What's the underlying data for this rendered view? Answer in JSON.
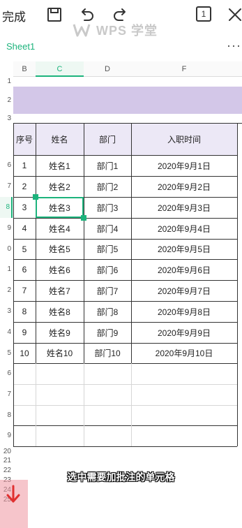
{
  "topbar": {
    "done_label": "完成",
    "page_count": "1",
    "icons": [
      "save-icon",
      "undo-icon",
      "redo-icon",
      "close-icon"
    ]
  },
  "watermark": {
    "text": "WPS 学堂"
  },
  "tabs": {
    "sheet_label": "Sheet1",
    "more_label": "···"
  },
  "columns": [
    "B",
    "C",
    "D",
    "F"
  ],
  "rows": [
    "1",
    "2",
    "3",
    "6",
    "7",
    "8",
    "9",
    "0",
    "1",
    "2",
    "3",
    "4",
    "5",
    "6",
    "7",
    "8",
    "9",
    "20",
    "21",
    "22",
    "23",
    "24",
    "25"
  ],
  "table": {
    "headers": [
      "序号",
      "姓名",
      "部门",
      "入职时间"
    ],
    "rows": [
      [
        "1",
        "姓名1",
        "部门1",
        "2020年9月1日"
      ],
      [
        "2",
        "姓名2",
        "部门2",
        "2020年9月2日"
      ],
      [
        "3",
        "姓名3",
        "部门3",
        "2020年9月3日"
      ],
      [
        "4",
        "姓名4",
        "部门4",
        "2020年9月4日"
      ],
      [
        "5",
        "姓名5",
        "部门5",
        "2020年9月5日"
      ],
      [
        "6",
        "姓名6",
        "部门6",
        "2020年9月6日"
      ],
      [
        "7",
        "姓名7",
        "部门7",
        "2020年9月7日"
      ],
      [
        "8",
        "姓名8",
        "部门8",
        "2020年9月8日"
      ],
      [
        "9",
        "姓名9",
        "部门9",
        "2020年9月9日"
      ],
      [
        "10",
        "姓名10",
        "部门10",
        "2020年9月10日"
      ]
    ]
  },
  "subtitle": "选中需要加批注的单元格",
  "colors": {
    "accent": "#1cb37c",
    "title_band": "#d3c7e8",
    "header_fill": "#ece8f6",
    "arrow": "#e03030"
  }
}
